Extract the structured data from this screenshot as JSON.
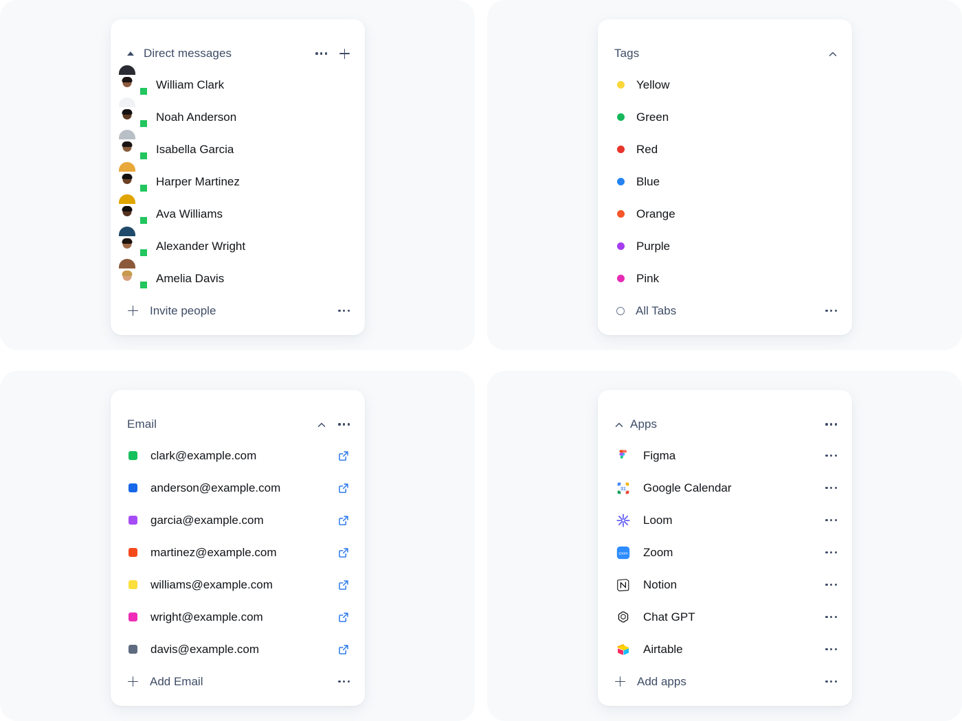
{
  "theme": {
    "panel_bg": "#f7f9fb",
    "card_bg": "#ffffff",
    "header_text": "#3e4c66",
    "item_text": "#111418",
    "accent_link": "#2563eb",
    "status_online": "#22c55e"
  },
  "panels": {
    "direct_messages": {
      "header": {
        "title": "Direct messages",
        "collapse_icon": "triangle-up-icon",
        "more_icon": "kebab-menu-icon",
        "add_icon": "plus-icon"
      },
      "items": [
        {
          "name": "William Clark",
          "avatar_bg": "#7b2fb5",
          "hair": "#1b1412",
          "skin": "#8d5a3f",
          "shirt": "#2b2b33",
          "status": "online"
        },
        {
          "name": "Noah Anderson",
          "avatar_bg": "#19c2de",
          "hair": "#161212",
          "skin": "#5c3a24",
          "shirt": "#f0f2f5",
          "status": "online"
        },
        {
          "name": "Isabella Garcia",
          "avatar_bg": "#2bbccc",
          "hair": "#1a1414",
          "skin": "#8a5c3e",
          "shirt": "#b9bfc7",
          "status": "online"
        },
        {
          "name": "Harper Martinez",
          "avatar_bg": "#1565d8",
          "hair": "#120f0f",
          "skin": "#6b4126",
          "shirt": "#e8a83a",
          "status": "online"
        },
        {
          "name": "Ava Williams",
          "avatar_bg": "#f3b41b",
          "hair": "#140f0f",
          "skin": "#53321e",
          "shirt": "#e0a500",
          "status": "online"
        },
        {
          "name": "Alexander Wright",
          "avatar_bg": "#7f9b2a",
          "hair": "#1d1410",
          "skin": "#a06c48",
          "shirt": "#1f4a6b",
          "status": "online"
        },
        {
          "name": "Amelia Davis",
          "avatar_bg": "#7a3aa8",
          "hair": "#c79a4e",
          "skin": "#d6a07a",
          "shirt": "#8c5a3a",
          "status": "online"
        }
      ],
      "footer": {
        "label": "Invite people",
        "lead_icon": "plus-icon",
        "more_icon": "kebab-menu-icon"
      }
    },
    "tags": {
      "header": {
        "title": "Tags",
        "collapse_icon": "chevron-up-icon"
      },
      "items": [
        {
          "label": "Yellow",
          "color": "#fbd73a"
        },
        {
          "label": "Green",
          "color": "#16b85b"
        },
        {
          "label": "Red",
          "color": "#e8342b"
        },
        {
          "label": "Blue",
          "color": "#2684f0"
        },
        {
          "label": "Orange",
          "color": "#f5562a"
        },
        {
          "label": "Purple",
          "color": "#a63df0"
        },
        {
          "label": "Pink",
          "color": "#e62bb5"
        }
      ],
      "footer": {
        "label": "All Tabs",
        "lead_icon": "circle-outline-icon",
        "more_icon": "kebab-menu-icon"
      }
    },
    "email": {
      "header": {
        "title": "Email",
        "collapse_icon": "chevron-up-icon",
        "more_icon": "kebab-menu-icon"
      },
      "items": [
        {
          "address": "clark@example.com",
          "color": "#16c05c",
          "action_icon": "external-link-icon"
        },
        {
          "address": "anderson@example.com",
          "color": "#1768e8",
          "action_icon": "external-link-icon"
        },
        {
          "address": "garcia@example.com",
          "color": "#a64cf5",
          "action_icon": "external-link-icon"
        },
        {
          "address": "martinez@example.com",
          "color": "#f5491c",
          "action_icon": "external-link-icon"
        },
        {
          "address": "williams@example.com",
          "color": "#fbdf3e",
          "action_icon": "external-link-icon"
        },
        {
          "address": "wright@example.com",
          "color": "#f02bb8",
          "action_icon": "external-link-icon"
        },
        {
          "address": "davis@example.com",
          "color": "#5e6b80",
          "action_icon": "external-link-icon"
        }
      ],
      "footer": {
        "label": "Add Email",
        "lead_icon": "plus-icon",
        "more_icon": "kebab-menu-icon"
      }
    },
    "apps": {
      "header": {
        "title": "Apps",
        "collapse_icon": "chevron-up-icon",
        "more_icon": "kebab-menu-icon"
      },
      "items": [
        {
          "label": "Figma",
          "icon": "figma-icon",
          "more_icon": "kebab-menu-icon"
        },
        {
          "label": "Google Calendar",
          "icon": "google-calendar-icon",
          "more_icon": "kebab-menu-icon"
        },
        {
          "label": "Loom",
          "icon": "loom-icon",
          "more_icon": "kebab-menu-icon"
        },
        {
          "label": "Zoom",
          "icon": "zoom-icon",
          "more_icon": "kebab-menu-icon"
        },
        {
          "label": "Notion",
          "icon": "notion-icon",
          "more_icon": "kebab-menu-icon"
        },
        {
          "label": "Chat GPT",
          "icon": "chatgpt-icon",
          "more_icon": "kebab-menu-icon"
        },
        {
          "label": "Airtable",
          "icon": "airtable-icon",
          "more_icon": "kebab-menu-icon"
        }
      ],
      "footer": {
        "label": "Add apps",
        "lead_icon": "plus-icon",
        "more_icon": "kebab-menu-icon"
      }
    }
  }
}
